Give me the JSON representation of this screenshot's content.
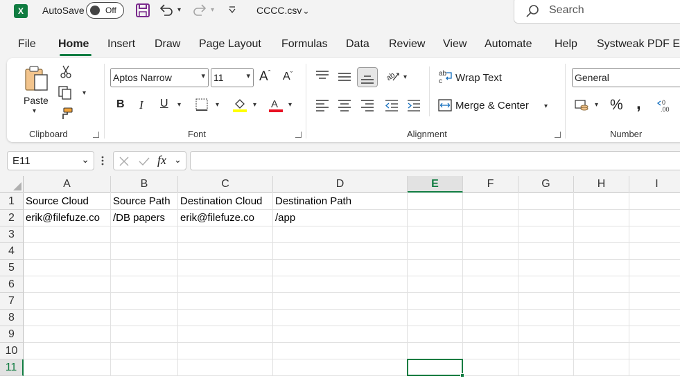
{
  "titlebar": {
    "autosave_label": "AutoSave",
    "autosave_state": "Off",
    "filename": "CCCC.csv",
    "search_placeholder": "Search"
  },
  "menu": [
    {
      "label": "File"
    },
    {
      "label": "Home",
      "active": true
    },
    {
      "label": "Insert"
    },
    {
      "label": "Draw"
    },
    {
      "label": "Page Layout"
    },
    {
      "label": "Formulas"
    },
    {
      "label": "Data"
    },
    {
      "label": "Review"
    },
    {
      "label": "View"
    },
    {
      "label": "Automate"
    },
    {
      "label": "Help"
    },
    {
      "label": "Systweak PDF Ed"
    }
  ],
  "ribbon": {
    "clipboard": {
      "paste_label": "Paste",
      "group_label": "Clipboard"
    },
    "font": {
      "font_name": "Aptos Narrow",
      "font_size": "11",
      "group_label": "Font"
    },
    "alignment": {
      "wrap_text": "Wrap Text",
      "merge_center": "Merge & Center",
      "group_label": "Alignment"
    },
    "number": {
      "format": "General",
      "group_label": "Number"
    }
  },
  "formula_bar": {
    "name_box": "E11",
    "fx": "fx",
    "formula": ""
  },
  "grid": {
    "columns": [
      "A",
      "B",
      "C",
      "D",
      "E",
      "F",
      "G",
      "H",
      "I"
    ],
    "rows": [
      "1",
      "2",
      "3",
      "4",
      "5",
      "6",
      "7",
      "8",
      "9",
      "10",
      "11"
    ],
    "cells": [
      [
        "Source Cloud",
        "Source Path",
        "Destination Cloud",
        "Destination Path"
      ],
      [
        "erik@filefuze.co",
        "/DB papers",
        "erik@filefuze.co",
        "/app"
      ]
    ],
    "selected_column": "E",
    "selected_row": "11"
  },
  "colors": {
    "accent": "#107c41",
    "font_color": "#e81123",
    "highlight": "#ffff00"
  }
}
